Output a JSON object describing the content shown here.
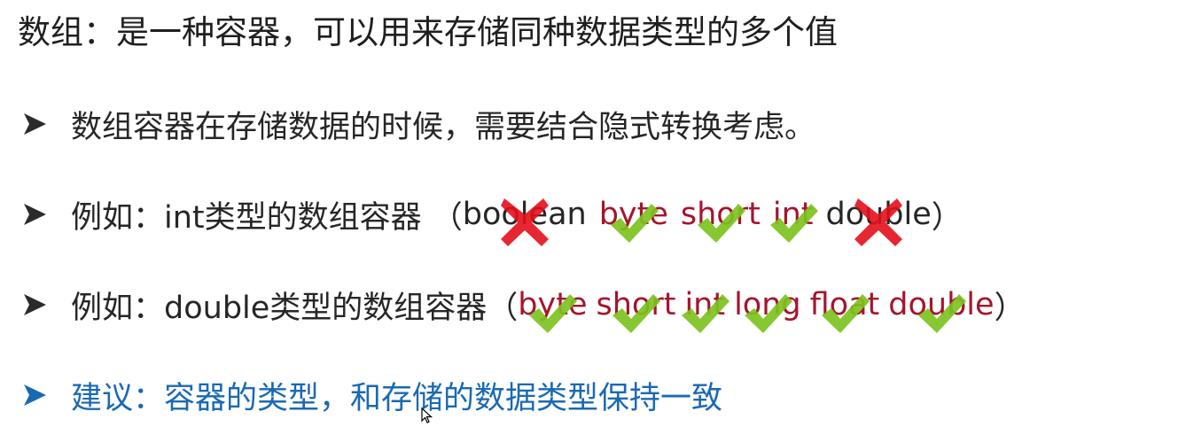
{
  "title": "数组：是一种容器，可以用来存储同种数据类型的多个值",
  "bullet1": {
    "text": "数组容器在存储数据的时候，需要结合隐式转换考虑。"
  },
  "bullet2": {
    "prefix": "例如：int类型的数组容器 （",
    "items": [
      {
        "label": "boolean",
        "highlight": false,
        "mark": "cross-icon"
      },
      {
        "label": "byte",
        "highlight": true,
        "mark": "check-icon"
      },
      {
        "label": "short",
        "highlight": true,
        "mark": "check-icon"
      },
      {
        "label": "int",
        "highlight": true,
        "mark": "check-icon"
      },
      {
        "label": "double",
        "highlight": false,
        "mark": "cross-icon"
      }
    ],
    "suffix": "）"
  },
  "bullet3": {
    "prefix": "例如：double类型的数组容器（",
    "items": [
      {
        "label": "byte",
        "highlight": true,
        "mark": "check-icon"
      },
      {
        "label": "short",
        "highlight": true,
        "mark": "check-icon"
      },
      {
        "label": "int",
        "highlight": true,
        "mark": "check-icon"
      },
      {
        "label": "long",
        "highlight": true,
        "mark": "check-icon"
      },
      {
        "label": "float",
        "highlight": true,
        "mark": "check-icon"
      },
      {
        "label": "double",
        "highlight": true,
        "mark": "check-icon"
      }
    ],
    "suffix": "）"
  },
  "bullet4": {
    "text": "建议：容器的类型，和存储的数据类型保持一致"
  },
  "colors": {
    "text": "#262626",
    "highlight_red": "#a5142d",
    "suggestion_blue": "#1a69b3",
    "check_green": "#7dc21f",
    "cross_red": "#e3101c"
  }
}
